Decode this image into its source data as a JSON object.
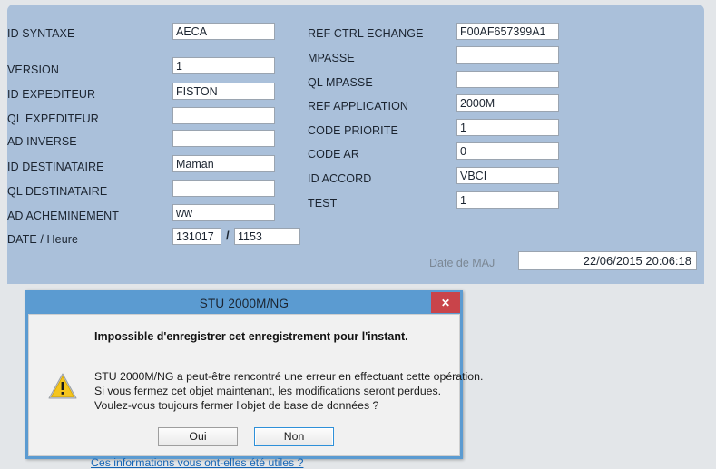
{
  "colors": {
    "panel_bg": "#aac0da",
    "desktop_bg": "#e3e6e9",
    "dialog_frame": "#5b9bd1",
    "dialog_body": "#f1f1f1",
    "close_button": "#c9444a",
    "link": "#1464b4",
    "warning_yellow": "#f5c51e"
  },
  "form": {
    "left_column": [
      {
        "label": "ID SYNTAXE",
        "value": "AECA"
      },
      {
        "label": "VERSION",
        "value": "1"
      },
      {
        "label": "ID EXPEDITEUR",
        "value": "FISTON"
      },
      {
        "label": "QL EXPEDITEUR",
        "value": ""
      },
      {
        "label": "AD INVERSE",
        "value": ""
      },
      {
        "label": "ID DESTINATAIRE",
        "value": "Maman"
      },
      {
        "label": "QL DESTINATAIRE",
        "value": ""
      },
      {
        "label": "AD ACHEMINEMENT",
        "value": "ww"
      }
    ],
    "date_heure": {
      "label": "DATE / Heure",
      "separator": "/",
      "date_value": "131017",
      "time_value": "1153"
    },
    "right_column": [
      {
        "label": "REF CTRL ECHANGE",
        "value": "F00AF657399A1"
      },
      {
        "label": "MPASSE",
        "value": ""
      },
      {
        "label": "QL MPASSE",
        "value": ""
      },
      {
        "label": "REF APPLICATION",
        "value": "2000M"
      },
      {
        "label": "CODE PRIORITE",
        "value": "1"
      },
      {
        "label": "CODE AR",
        "value": "0"
      },
      {
        "label": "ID ACCORD",
        "value": "VBCI"
      },
      {
        "label": "TEST",
        "value": "1"
      }
    ],
    "date_maj": {
      "label": "Date de MAJ",
      "value": "22/06/2015 20:06:18"
    }
  },
  "dialog": {
    "title": "STU 2000M/NG",
    "close_icon": "close-icon",
    "close_label": "✕",
    "heading": "Impossible d'enregistrer cet enregistrement pour l'instant.",
    "icon": "warning-icon",
    "body_lines": [
      "STU 2000M/NG a peut-être rencontré une erreur en effectuant cette opération.",
      "Si vous fermez cet objet maintenant, les modifications seront perdues.",
      "Voulez-vous toujours fermer l'objet de base de données ?"
    ],
    "buttons": [
      {
        "label": "Oui",
        "focused": false
      },
      {
        "label": "Non",
        "focused": true
      }
    ],
    "link": "Ces informations vous ont-elles été utiles ?"
  }
}
